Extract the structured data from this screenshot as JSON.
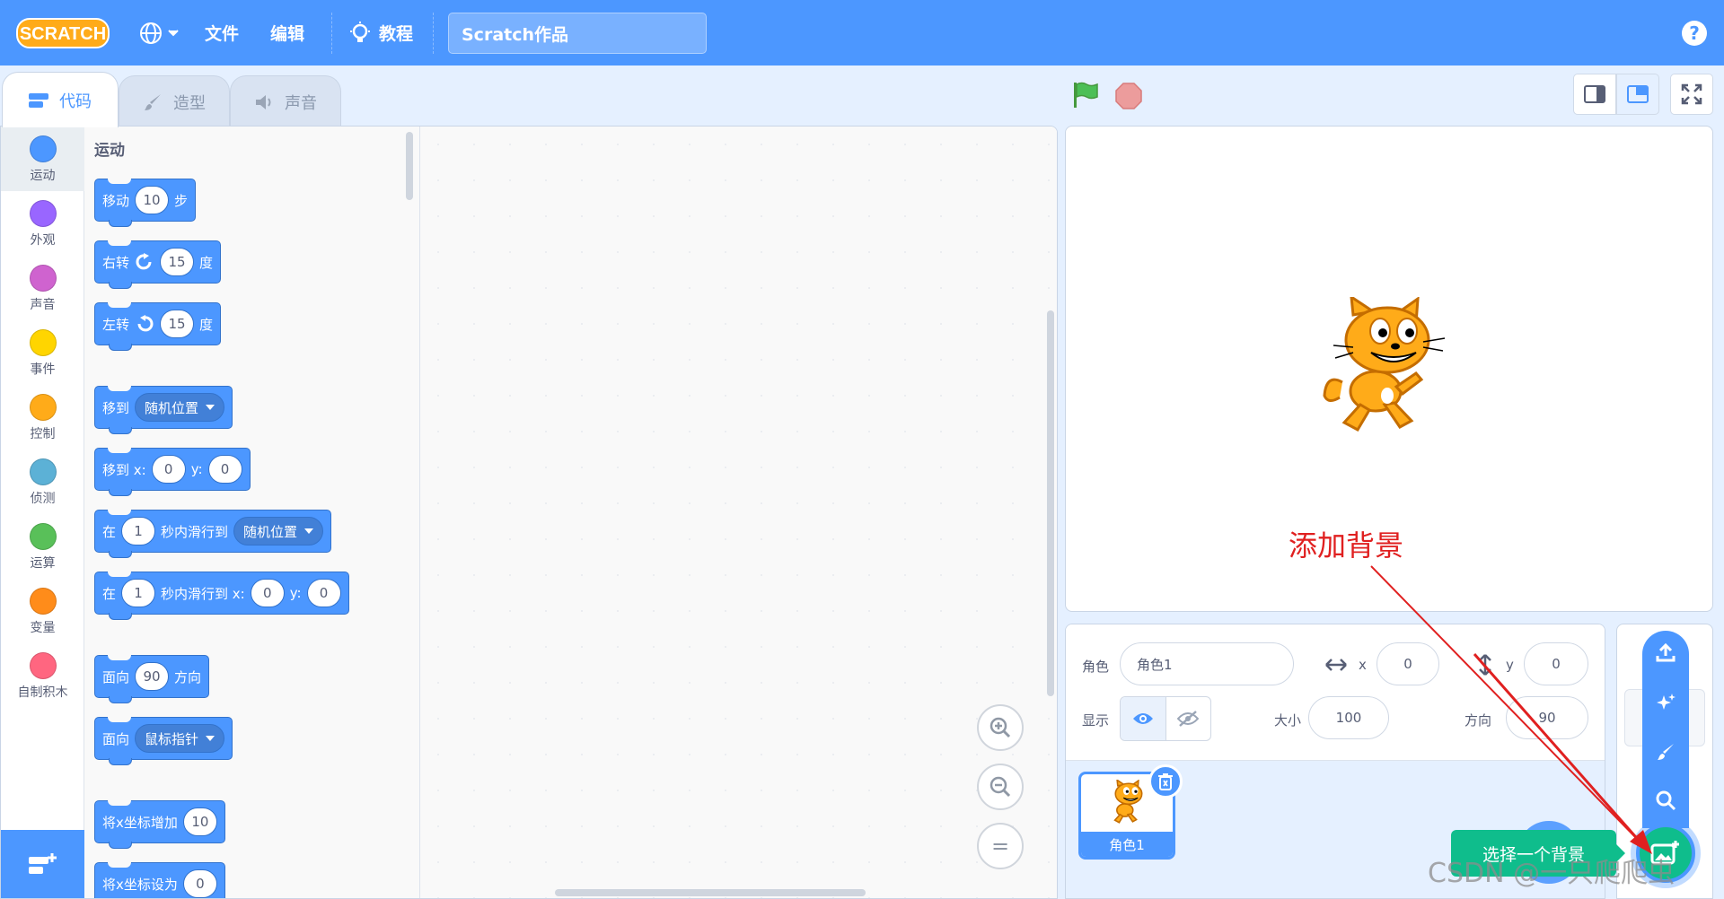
{
  "menubar": {
    "logo_text": "SCRATCH",
    "file_label": "文件",
    "edit_label": "编辑",
    "tutorials_label": "教程",
    "project_title": "Scratch作品",
    "help_label": "?"
  },
  "tabs": [
    {
      "label": "代码",
      "icon": "code-icon"
    },
    {
      "label": "造型",
      "icon": "brush-icon"
    },
    {
      "label": "声音",
      "icon": "speaker-icon"
    }
  ],
  "categories": [
    {
      "label": "运动",
      "color": "#4c97ff"
    },
    {
      "label": "外观",
      "color": "#9966ff"
    },
    {
      "label": "声音",
      "color": "#cf63cf"
    },
    {
      "label": "事件",
      "color": "#ffd500"
    },
    {
      "label": "控制",
      "color": "#ffab19"
    },
    {
      "label": "侦测",
      "color": "#5cb1d6"
    },
    {
      "label": "运算",
      "color": "#59c059"
    },
    {
      "label": "变量",
      "color": "#ff8c1a"
    },
    {
      "label": "自制积木",
      "color": "#ff6680"
    }
  ],
  "palette": {
    "title": "运动",
    "blocks": {
      "move": {
        "a": "移动",
        "n": "10",
        "b": "步"
      },
      "turn_right": {
        "a": "右转",
        "n": "15",
        "b": "度"
      },
      "turn_left": {
        "a": "左转",
        "n": "15",
        "b": "度"
      },
      "goto": {
        "a": "移到",
        "dd": "随机位置"
      },
      "goto_xy": {
        "a": "移到 x:",
        "x": "0",
        "ylabel": "y:",
        "y": "0"
      },
      "glide": {
        "a": "在",
        "n": "1",
        "b": "秒内滑行到",
        "dd": "随机位置"
      },
      "glide_xy": {
        "a": "在",
        "n": "1",
        "b": "秒内滑行到 x:",
        "x": "0",
        "ylabel": "y:",
        "y": "0"
      },
      "point_dir": {
        "a": "面向",
        "n": "90",
        "b": "方向"
      },
      "point_towards": {
        "a": "面向",
        "dd": "鼠标指针"
      },
      "change_x": {
        "a": "将x坐标增加",
        "n": "10"
      },
      "set_x": {
        "a": "将x坐标设为",
        "n": "0"
      }
    }
  },
  "zoom": {
    "in": "+",
    "out": "−",
    "reset": "="
  },
  "stage": {
    "annotation": "添加背景"
  },
  "sprite_info": {
    "sprite_label": "角色",
    "sprite_name": "角色1",
    "x_label": "x",
    "x_value": "0",
    "y_label": "y",
    "y_value": "0",
    "show_label": "显示",
    "size_label": "大小",
    "size_value": "100",
    "direction_label": "方向",
    "direction_value": "90"
  },
  "sprites": [
    {
      "name": "角色1"
    }
  ],
  "backdrop_tooltip": "选择一个背景",
  "watermark": "CSDN @一只爬爬虫",
  "colors": {
    "brand": "#4c97ff",
    "add_backdrop": "#0fbd8c",
    "annotation": "#e02020"
  }
}
